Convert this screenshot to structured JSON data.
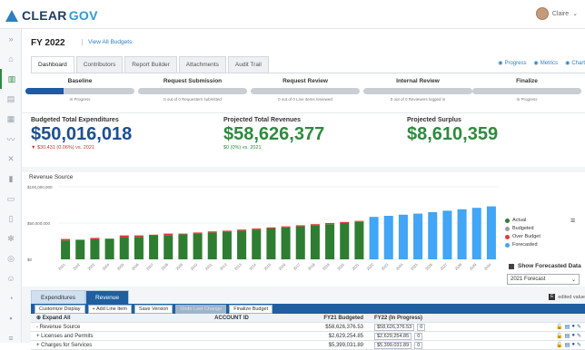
{
  "brand": {
    "name_a": "CLEAR",
    "name_b": "GOV"
  },
  "user": {
    "name": "Claire",
    "caret": "⌄"
  },
  "page": {
    "title": "FY 2022",
    "view_all": "View All Budgets"
  },
  "tabs": [
    "Dashboard",
    "Contributors",
    "Report Builder",
    "Attachments",
    "Audit Trail"
  ],
  "toggles": [
    "Progress",
    "Metrics",
    "Chart"
  ],
  "stages": [
    {
      "title": "Baseline",
      "progress": 0.35,
      "sub": "In Progress"
    },
    {
      "title": "Request Submission",
      "progress": 0,
      "sub": "0 out of 0 Requesters submitted"
    },
    {
      "title": "Request Review",
      "progress": 0,
      "sub": "0 out of 0 Line items reviewed"
    },
    {
      "title": "Internal Review",
      "progress": 0,
      "sub": "0 out of 0 Reviewers logged in"
    },
    {
      "title": "Finalize",
      "progress": 0,
      "sub": "In Progress"
    }
  ],
  "kpis": [
    {
      "label": "Budgeted Total Expenditures",
      "value": "$50,016,018",
      "delta": "▼ $30,431 (0.06%) vs. 2021",
      "color": "#1d4f8f",
      "delta_color": "#c0392b"
    },
    {
      "label": "Projected Total Revenues",
      "value": "$58,626,377",
      "delta": "$0 (0%) vs. 2021",
      "color": "#2e8a3e",
      "delta_color": "#2e8a3e"
    },
    {
      "label": "Projected Surplus",
      "value": "$8,610,359",
      "delta": "",
      "color": "#2e8a3e",
      "delta_color": "#2e8a3e"
    }
  ],
  "chart_data": {
    "type": "bar",
    "title": "Revenue Source",
    "yticks": [
      "$100,000,000",
      "$50,000,000",
      "$0"
    ],
    "ylim": [
      0,
      100000000
    ],
    "categories": [
      "2001",
      "2002",
      "2003",
      "2004",
      "2005",
      "2006",
      "2007",
      "2008",
      "2009",
      "2010",
      "2011",
      "2012",
      "2013",
      "2014",
      "2015",
      "2016",
      "2017",
      "2018",
      "2019",
      "2020",
      "2021",
      "2022",
      "2023",
      "2024",
      "2025",
      "2026",
      "2027",
      "2028",
      "2029",
      "2030"
    ],
    "series": [
      {
        "name": "Actual",
        "color": "#2e7d32",
        "values": [
          26000000,
          27000000,
          27500000,
          28500000,
          30000000,
          31000000,
          32500000,
          33500000,
          34500000,
          35500000,
          37000000,
          38000000,
          39500000,
          41000000,
          42500000,
          44000000,
          45500000,
          47000000,
          48500000,
          50000000,
          51500000,
          0,
          0,
          0,
          0,
          0,
          0,
          0,
          0,
          0
        ]
      },
      {
        "name": "Budgeted",
        "color": "#9e9e9e",
        "values": [
          0,
          0,
          0,
          0,
          0,
          0,
          0,
          0,
          0,
          0,
          0,
          0,
          0,
          0,
          0,
          0,
          0,
          0,
          0,
          0,
          0,
          0,
          0,
          0,
          0,
          0,
          0,
          0,
          0,
          0
        ]
      },
      {
        "name": "Over Budget",
        "color": "#e53935",
        "values": [
          2000000,
          0,
          2000000,
          0,
          3000000,
          2000000,
          1500000,
          2000000,
          1000000,
          1500000,
          1500000,
          1500000,
          1500000,
          1500000,
          1500000,
          1500000,
          1500000,
          1500000,
          1500000,
          1500000,
          1500000,
          0,
          0,
          0,
          0,
          0,
          0,
          0,
          0,
          0
        ]
      },
      {
        "name": "Forecasted",
        "color": "#42a5f5",
        "values": [
          0,
          0,
          0,
          0,
          0,
          0,
          0,
          0,
          0,
          0,
          0,
          0,
          0,
          0,
          0,
          0,
          0,
          0,
          0,
          0,
          0,
          58500000,
          60000000,
          61500000,
          63000000,
          65000000,
          67000000,
          69000000,
          71000000,
          73000000
        ]
      }
    ],
    "forecast_toggle": "Show Forecasted Data",
    "forecast_select": "2021 Forecast"
  },
  "subtabs": [
    "Expenditures",
    "Revenue"
  ],
  "edited_label": "edited value",
  "toolbar": [
    "Customize Display",
    "+ Add Line Item",
    "Save Version",
    "Undo Last Change",
    "Finalize Budget"
  ],
  "grid": {
    "headers": [
      "Expand All",
      "ACCOUNT ID",
      "FY21 Budgeted",
      "FY22 (In Progress)"
    ],
    "rows": [
      {
        "name": "- Revenue Source",
        "id": "",
        "fy21": "$58,626,376.53",
        "fy22": "$58,626,376.53",
        "pct": "0"
      },
      {
        "name": "+ Licenses and Permits",
        "id": "",
        "fy21": "$2,629,254.85",
        "fy22": "$2,629,254.85",
        "pct": "0"
      },
      {
        "name": "+ Charges for Services",
        "id": "",
        "fy21": "$5,399,031.89",
        "fy22": "$5,399,031.89",
        "pct": "0"
      }
    ]
  }
}
